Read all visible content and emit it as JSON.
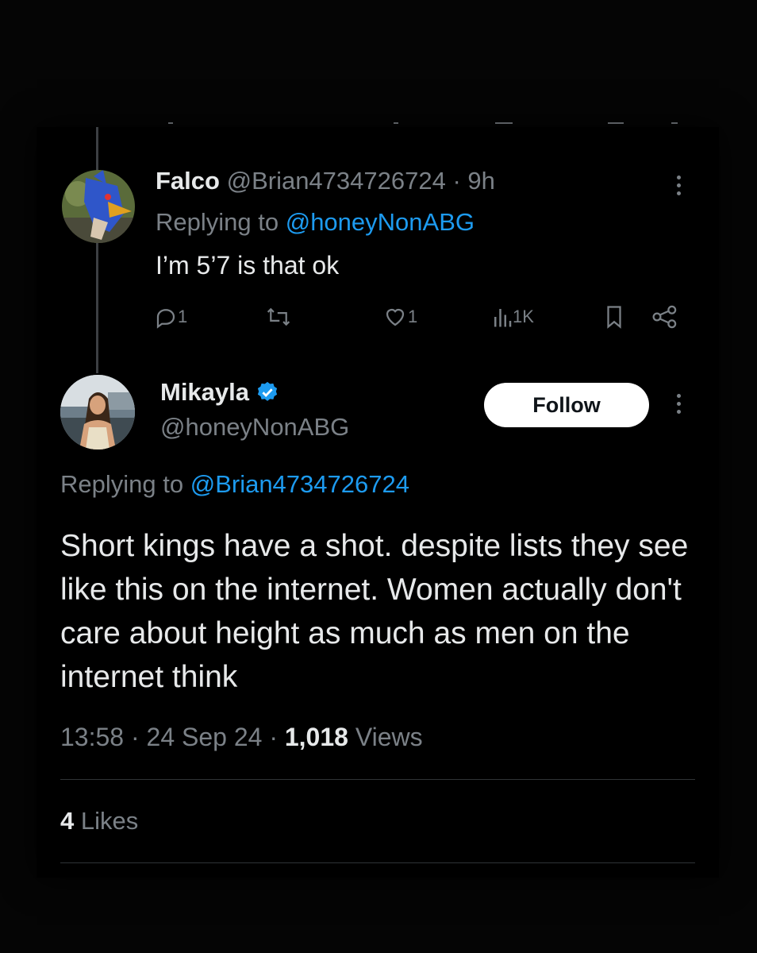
{
  "reply": {
    "author_name": "Falco",
    "author_handle": "@Brian4734726724",
    "separator": "·",
    "time": "9h",
    "replying_prefix": "Replying to",
    "replying_handle": "@honeyNonABG",
    "text": "I’m 5’7 is that ok",
    "counts": {
      "replies": "1",
      "retweets": "",
      "likes": "1",
      "views": "1K"
    }
  },
  "tweet": {
    "author_name": "Mikayla",
    "author_handle": "@honeyNonABG",
    "follow_label": "Follow",
    "replying_prefix": "Replying to",
    "replying_handle": "@Brian4734726724",
    "text": "Short kings have a shot. despite lists they see like this on the internet. Women actually don't care about height as much as men on the internet think",
    "time": "13:58",
    "date": "24 Sep 24",
    "views_count": "1,018",
    "views_label": "Views",
    "likes_count": "4",
    "likes_label": "Likes"
  },
  "colors": {
    "accent": "#1d9bf0",
    "muted": "#7b8187",
    "text": "#e7e9ea",
    "background": "#000000"
  }
}
